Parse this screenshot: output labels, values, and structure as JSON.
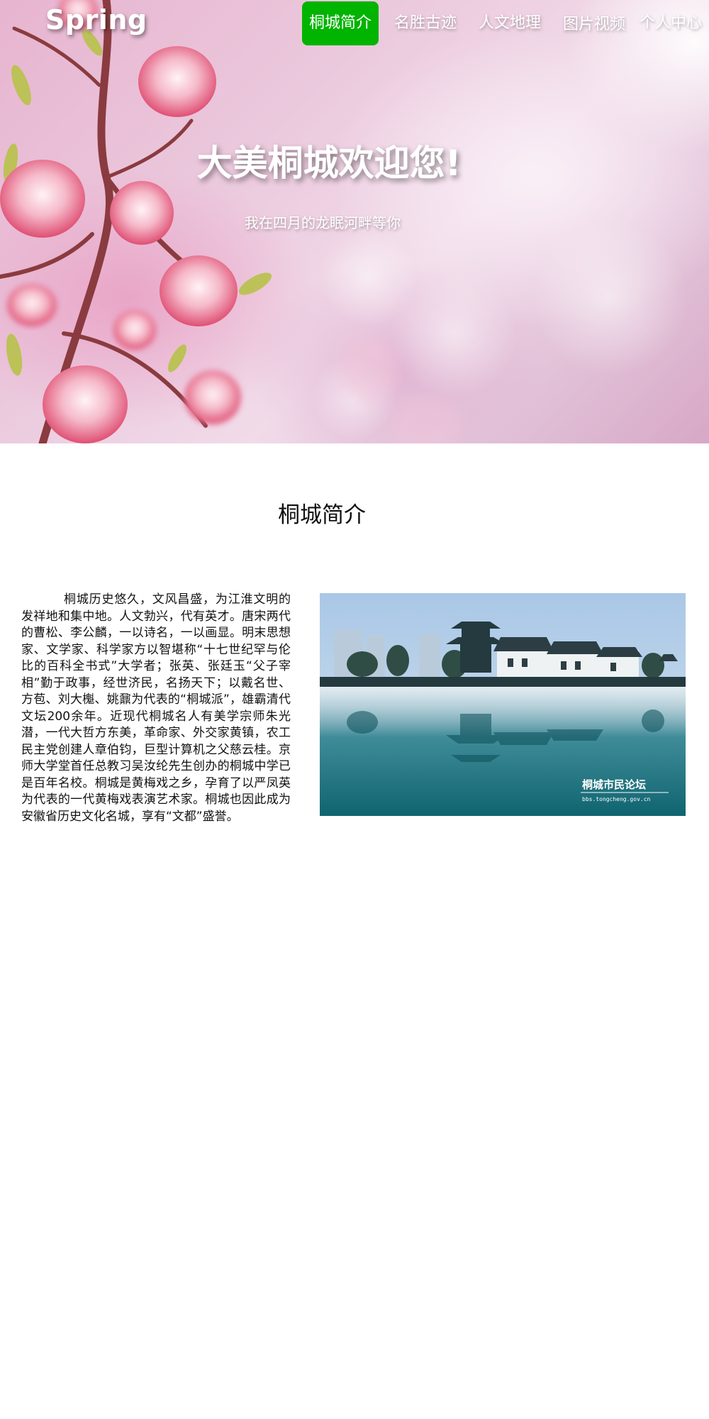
{
  "brand": "Spring",
  "nav": {
    "items": [
      {
        "label": "桐城简介",
        "active": true
      },
      {
        "label": "名胜古迹",
        "active": false
      },
      {
        "label": "人文地理",
        "active": false
      },
      {
        "label": "图片视频",
        "active": false
      },
      {
        "label": "个人中心",
        "active": false
      }
    ]
  },
  "hero": {
    "title": "大美桐城欢迎您!",
    "subtitle": "我在四月的龙眠河畔等你"
  },
  "intro": {
    "heading": "桐城简介",
    "body": "桐城历史悠久，文风昌盛，为江淮文明的发祥地和集中地。人文勃兴，代有英才。唐宋两代的曹松、李公麟，一以诗名，一以画显。明末思想家、文学家、科学家方以智堪称“十七世纪罕与伦比的百科全书式”大学者；张英、张廷玉“父子宰相”勤于政事，经世济民，名扬天下；以戴名世、方苞、刘大櫆、姚鼐为代表的“桐城派”，雄霸清代文坛200余年。近现代桐城名人有美学宗师朱光潜，一代大哲方东美，革命家、外交家黄镇，农工民主党创建人章伯钧，巨型计算机之父慈云桂。京师大学堂首任总教习吴汝纶先生创办的桐城中学已是百年名校。桐城是黄梅戏之乡，孕育了以严凤英为代表的一代黄梅戏表演艺术家。桐城也因此成为安徽省历史文化名城，享有“文都”盛誉。",
    "photo_watermark": "桐城市民论坛",
    "photo_url_text": "bbs.tongcheng.gov.cn"
  },
  "colors": {
    "nav_active": "#00b400",
    "text": "#111111"
  },
  "icons": {
    "hero_background": "peach-blossom-image",
    "intro_photo": "lakeside-pavilion-photo"
  }
}
